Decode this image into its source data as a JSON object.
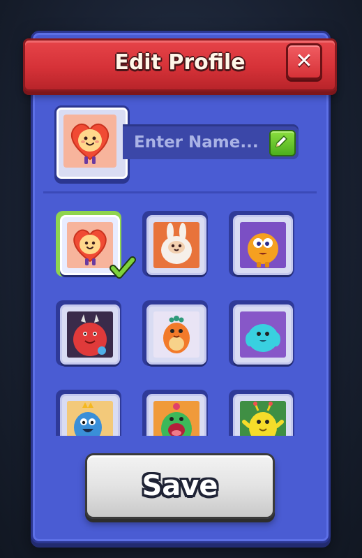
{
  "dialog": {
    "title": "Edit Profile",
    "close_icon": "close-x-icon"
  },
  "profile": {
    "selected_avatar": "heart-character",
    "name_placeholder": "Enter Name...",
    "name_value": "",
    "edit_icon": "pencil-icon"
  },
  "avatars": [
    {
      "id": "heart-character",
      "bg": "#f7b49c",
      "selected": true
    },
    {
      "id": "white-fluffy-bunny-monster",
      "bg": "#e8733b",
      "selected": false
    },
    {
      "id": "orange-fuzzy-monster",
      "bg": "#7b4fc4",
      "selected": false
    },
    {
      "id": "red-horned-monster",
      "bg": "#3a2b4a",
      "selected": false
    },
    {
      "id": "orange-dino-monster",
      "bg": "#e9e4f5",
      "selected": false
    },
    {
      "id": "cyan-furry-monster",
      "bg": "#8757c8",
      "selected": false
    },
    {
      "id": "blue-crowned-monster",
      "bg": "#f3c97a",
      "selected": false
    },
    {
      "id": "green-cactus-monster",
      "bg": "#f09a3a",
      "selected": false
    },
    {
      "id": "yellow-antenna-monster",
      "bg": "#3f8f44",
      "selected": false
    }
  ],
  "actions": {
    "save_label": "Save"
  },
  "colors": {
    "panel": "#4a5cd3",
    "title_bar": "#d63238",
    "selected_border": "#8fd44e",
    "save_button": "#e3e3e3"
  }
}
